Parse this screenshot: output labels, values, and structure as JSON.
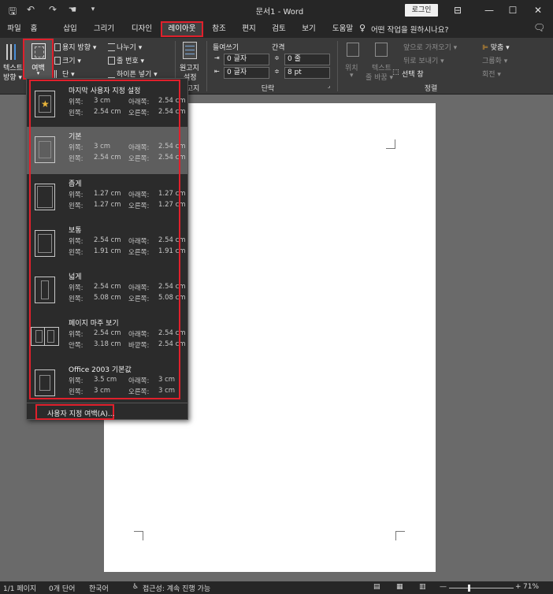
{
  "titlebar": {
    "title": "문서1 - Word",
    "login_label": "로그인",
    "icons": [
      "save-icon",
      "undo-icon",
      "redo-icon",
      "touch-mode-icon",
      "customize-icon"
    ],
    "save_glyph": "🖫",
    "undo_glyph": "↶",
    "redo_glyph": "↷",
    "touch_glyph": "☚",
    "customize_glyph": "▾",
    "display_glyph": "⊟",
    "min_glyph": "—",
    "max_glyph": "☐",
    "close_glyph": "✕"
  },
  "menu": {
    "tabs": [
      "파일",
      "홈",
      "삽입",
      "그리기",
      "디자인",
      "레이아웃",
      "참조",
      "편지",
      "검토",
      "보기",
      "도움말"
    ],
    "active": "레이아웃",
    "tell_me": "어떤 작업을 원하시나요?",
    "tell_me_glyph": "♀",
    "comment_glyph": "🗨"
  },
  "ribbon": {
    "text_direction_top": "텍스트",
    "text_direction_bottom": "방향 ▾",
    "margins_label": "여백",
    "margins_caret": "▾",
    "orientation": "용지 방향 ▾",
    "size": "크기 ▾",
    "columns": "단 ▾",
    "breaks": "나누기 ▾",
    "line_numbers": "줄 번호 ▾",
    "hyphenation": "하이픈 넣기 ▾",
    "manuscript_top": "원고지",
    "manuscript_bottom": "설정",
    "manuscript_group": "고지",
    "indent_header": "들여쓰기",
    "spacing_header": "간격",
    "indent_left": "0 글자",
    "indent_right": "0 글자",
    "spacing_before": "0 줄",
    "spacing_after": "8 pt",
    "paragraph_group": "단락",
    "position": "위치",
    "position_sub": "▾",
    "wrap_text": "텍스트",
    "wrap_text_sub": "줄 바꿈 ▾",
    "bring_forward": "앞으로 가져오기 ▾",
    "send_backward": "뒤로 보내기 ▾",
    "selection_pane": "선택 창",
    "align": "맞춤 ▾",
    "group": "그룹화 ▾",
    "rotate": "회전 ▾",
    "arrange_group": "정렬"
  },
  "margins_menu": {
    "items": [
      {
        "title": "마지막 사용자 지정 설정",
        "l1": "위쪽:",
        "v1": "3 cm",
        "l2": "아래쪽:",
        "v2": "2.54 cm",
        "l3": "왼쪽:",
        "v3": "2.54 cm",
        "l4": "오른쪽:",
        "v4": "2.54 cm"
      },
      {
        "title": "기본",
        "l1": "위쪽:",
        "v1": "3 cm",
        "l2": "아래쪽:",
        "v2": "2.54 cm",
        "l3": "왼쪽:",
        "v3": "2.54 cm",
        "l4": "오른쪽:",
        "v4": "2.54 cm"
      },
      {
        "title": "좁게",
        "l1": "위쪽:",
        "v1": "1.27 cm",
        "l2": "아래쪽:",
        "v2": "1.27 cm",
        "l3": "왼쪽:",
        "v3": "1.27 cm",
        "l4": "오른쪽:",
        "v4": "1.27 cm"
      },
      {
        "title": "보통",
        "l1": "위쪽:",
        "v1": "2.54 cm",
        "l2": "아래쪽:",
        "v2": "2.54 cm",
        "l3": "왼쪽:",
        "v3": "1.91 cm",
        "l4": "오른쪽:",
        "v4": "1.91 cm"
      },
      {
        "title": "넓게",
        "l1": "위쪽:",
        "v1": "2.54 cm",
        "l2": "아래쪽:",
        "v2": "2.54 cm",
        "l3": "왼쪽:",
        "v3": "5.08 cm",
        "l4": "오른쪽:",
        "v4": "5.08 cm"
      },
      {
        "title": "페이지 마주 보기",
        "l1": "위쪽:",
        "v1": "2.54 cm",
        "l2": "아래쪽:",
        "v2": "2.54 cm",
        "l3": "안쪽:",
        "v3": "3.18 cm",
        "l4": "바깥쪽:",
        "v4": "2.54 cm"
      },
      {
        "title": "Office 2003 기본값",
        "l1": "위쪽:",
        "v1": "3.5 cm",
        "l2": "아래쪽:",
        "v2": "3 cm",
        "l3": "왼쪽:",
        "v3": "3 cm",
        "l4": "오른쪽:",
        "v4": "3 cm"
      }
    ],
    "selected_index": 1,
    "star_glyph": "★",
    "custom_label": "사용자 지정 여백(A)..."
  },
  "status": {
    "page": "1/1 페이지",
    "words": "0개 단어",
    "language": "한국어",
    "accessibility": "접근성: 계속 진행 가능",
    "accessibility_glyph": "♿",
    "zoom": "71%",
    "zoom_minus": "—",
    "zoom_plus": "+",
    "view_read_glyph": "▤",
    "view_print_glyph": "▦",
    "view_web_glyph": "▥"
  }
}
